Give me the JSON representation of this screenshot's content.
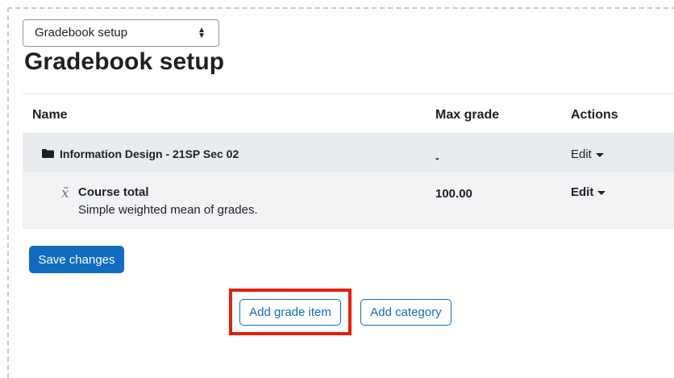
{
  "nav_select": {
    "value": "Gradebook setup"
  },
  "page": {
    "title": "Gradebook setup"
  },
  "table": {
    "headers": {
      "name": "Name",
      "max_grade": "Max grade",
      "actions": "Actions"
    },
    "category_row": {
      "name": "Information Design - 21SP Sec 02",
      "max_grade": "-",
      "action": "Edit",
      "icon": "folder-icon"
    },
    "total_row": {
      "name": "Course total",
      "description": "Simple weighted mean of grades.",
      "max_grade": "100.00",
      "action": "Edit",
      "icon": "x-bar-mean-icon"
    }
  },
  "buttons": {
    "save": "Save changes",
    "add_grade_item": "Add grade item",
    "add_category": "Add category"
  },
  "colors": {
    "primary": "#0f6cbf",
    "highlight": "#e02010",
    "category_row_bg": "#e9ecef"
  }
}
